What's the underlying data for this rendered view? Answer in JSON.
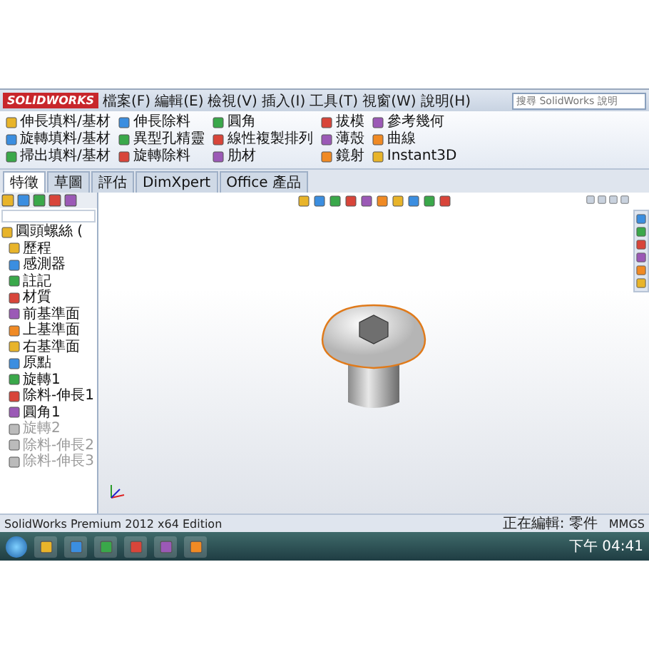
{
  "app": {
    "logo": "SOLIDWORKS",
    "menus": [
      "檔案(F)",
      "編輯(E)",
      "檢視(V)",
      "插入(I)",
      "工具(T)",
      "視窗(W)",
      "說明(H)"
    ],
    "search": {
      "placeholder": "搜尋 SolidWorks 說明"
    }
  },
  "ribbon": {
    "groups": [
      {
        "items": [
          {
            "label": "伸長填料/基材"
          },
          {
            "label": "旋轉填料/基材"
          },
          {
            "label": "掃出填料/基材"
          }
        ]
      },
      {
        "items": [
          {
            "label": "伸長除料"
          },
          {
            "label": "異型孔精靈"
          },
          {
            "label": "旋轉除料"
          }
        ]
      },
      {
        "items": [
          {
            "label": "圓角"
          },
          {
            "label": "線性複製排列"
          },
          {
            "label": "肋材"
          }
        ]
      },
      {
        "items": [
          {
            "label": "拔模"
          },
          {
            "label": "薄殼"
          },
          {
            "label": "鏡射"
          }
        ]
      },
      {
        "items": [
          {
            "label": "參考幾何"
          },
          {
            "label": "曲線"
          },
          {
            "label": "Instant3D"
          }
        ]
      }
    ]
  },
  "tabs": [
    {
      "label": "特徵",
      "selected": true
    },
    {
      "label": "草圖",
      "selected": false
    },
    {
      "label": "評估",
      "selected": false
    },
    {
      "label": "DimXpert",
      "selected": false
    },
    {
      "label": "Office 產品",
      "selected": false
    }
  ],
  "feature_tree": {
    "root": "圓頭螺絲 (",
    "items": [
      {
        "label": "歷程",
        "suppressed": false
      },
      {
        "label": "感測器",
        "suppressed": false
      },
      {
        "label": "註記",
        "suppressed": false
      },
      {
        "label": "材質",
        "suppressed": false
      },
      {
        "label": "前基準面",
        "suppressed": false
      },
      {
        "label": "上基準面",
        "suppressed": false
      },
      {
        "label": "右基準面",
        "suppressed": false
      },
      {
        "label": "原點",
        "suppressed": false
      },
      {
        "label": "旋轉1",
        "suppressed": false
      },
      {
        "label": "除料-伸長1",
        "suppressed": false
      },
      {
        "label": "圓角1",
        "suppressed": false
      },
      {
        "label": "旋轉2",
        "suppressed": true
      },
      {
        "label": "除料-伸長2",
        "suppressed": true
      },
      {
        "label": "除料-伸長3",
        "suppressed": true
      }
    ]
  },
  "status_bar": {
    "product": "SolidWorks Premium 2012 x64 Edition",
    "editing": "正在編輯: 零件",
    "units": "MMGS"
  },
  "taskbar": {
    "clock": "下午 04:41"
  }
}
